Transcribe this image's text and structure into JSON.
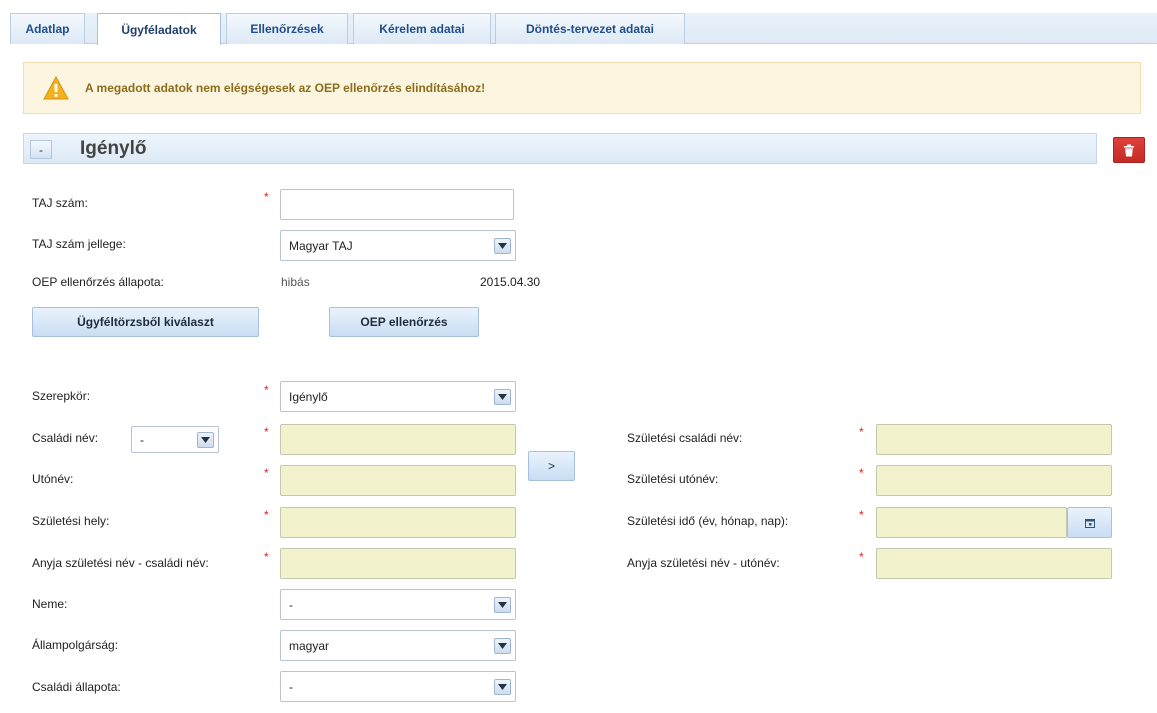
{
  "tabs": [
    "Adatlap",
    "Ügyféladatok",
    "Ellenőrzések",
    "Kérelem adatai",
    "Döntés-tervezet adatai"
  ],
  "warning": {
    "message": "A megadott adatok nem elégségesek az OEP ellenőrzés elindításához!"
  },
  "section": {
    "collapse_label": "-",
    "title": "Igénylő"
  },
  "form": {
    "taj_label": "TAJ szám:",
    "taj_type_label": "TAJ szám jellege:",
    "taj_type_value": "Magyar TAJ",
    "oep_status_label": "OEP ellenőrzés állapota:",
    "oep_status_value": "hibás",
    "oep_status_date": "2015.04.30",
    "select_client_button": "Ügyféltörzsből kiválaszt",
    "oep_check_button": "OEP ellenőrzés",
    "role_label": "Szerepkör:",
    "role_value": "Igénylő",
    "family_name_label": "Családi név:",
    "family_name_prefix_value": "-",
    "given_name_label": "Utónév:",
    "birth_place_label": "Születési hely:",
    "mother_family_label": "Anyja születési név - családi név:",
    "gender_label": "Neme:",
    "gender_value": "-",
    "citizenship_label": "Állampolgárság:",
    "citizenship_value": "magyar",
    "marital_label": "Családi állapota:",
    "marital_value": "-",
    "copy_button": ">",
    "birth_family_name_label": "Születési családi név:",
    "birth_given_name_label": "Születési utónév:",
    "birth_date_label": "Születési idő (év, hónap, nap):",
    "mother_given_label": "Anyja születési név - utónév:",
    "required_mark": "*"
  },
  "colors": {
    "accent": "#1f4e8c",
    "warning_bg": "#fcf5e0",
    "required_bg": "#f2f2cc",
    "delete": "#c42a24"
  },
  "icons": [
    "warning-icon",
    "trash-icon",
    "chevron-down-icon",
    "calendar-icon"
  ]
}
